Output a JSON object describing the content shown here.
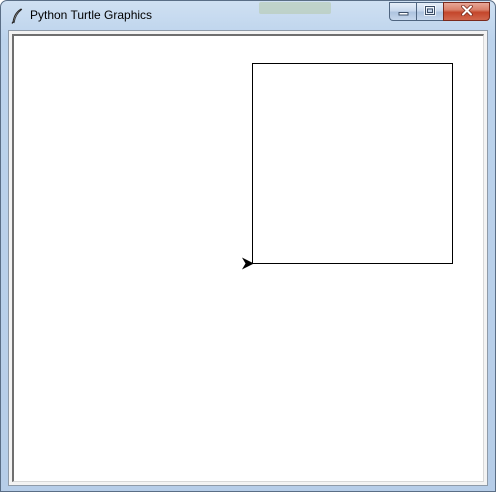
{
  "window": {
    "title": "Python Turtle Graphics",
    "app_icon": "feather-quill-icon"
  },
  "controls": {
    "minimize_icon": "minimize-icon",
    "maximize_icon": "maximize-icon",
    "close_icon": "close-icon"
  },
  "canvas": {
    "background": "#ffffff",
    "drawing": {
      "shape": "square",
      "stroke_color": "#000000",
      "turtle_cursor": "arrow-cursor-icon",
      "turtle_heading": "east"
    }
  }
}
